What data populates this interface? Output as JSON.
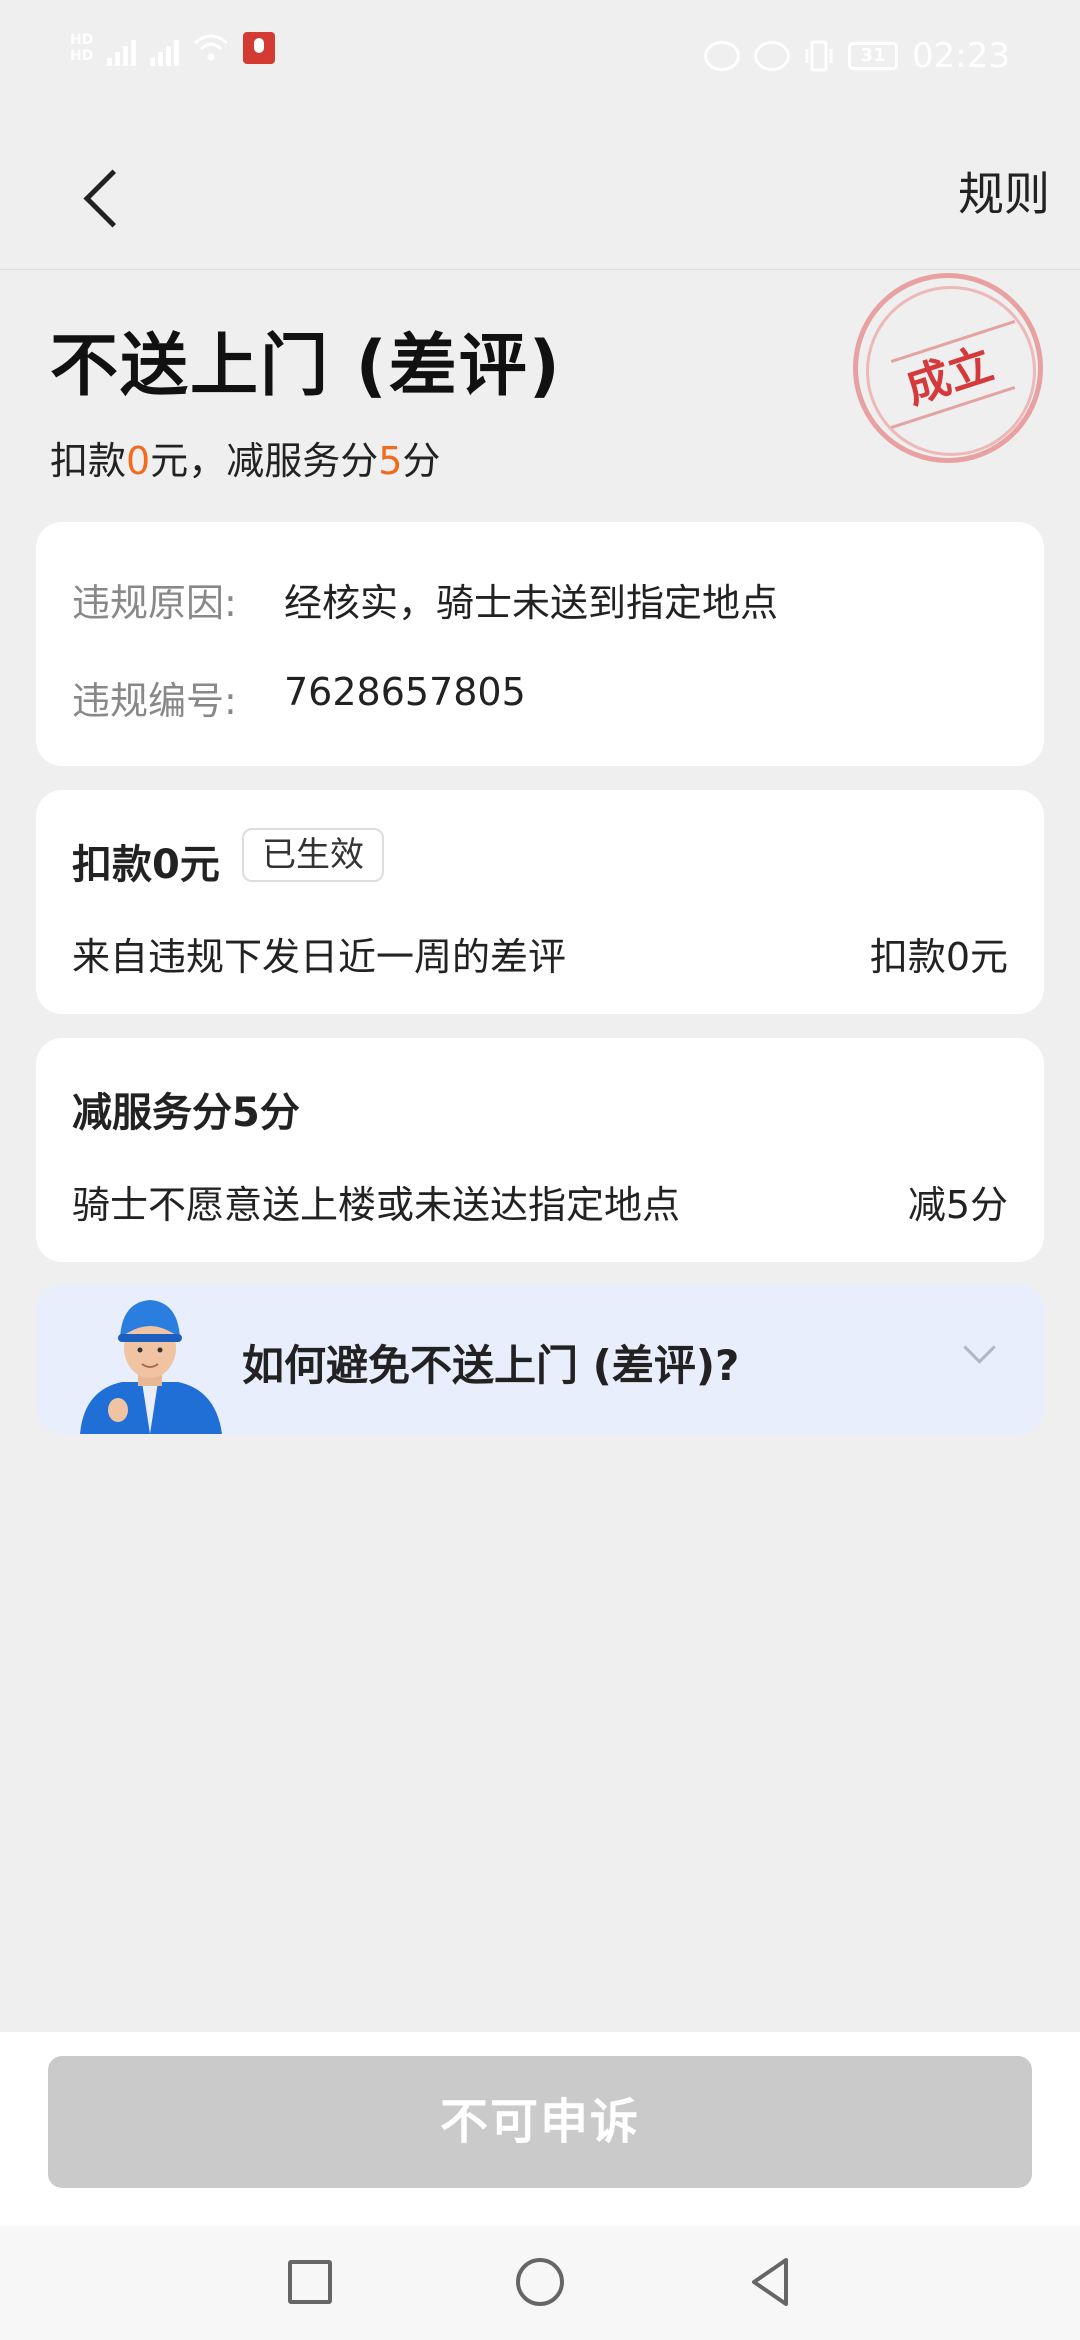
{
  "status_bar": {
    "time": "02:23",
    "battery": "31",
    "network_labels": [
      "HD",
      "HD"
    ],
    "colors": {
      "mic_badge": "#d23a32"
    }
  },
  "header": {
    "back_icon": "chevron-left-icon",
    "rules_label": "规则"
  },
  "summary": {
    "title": "不送上门 (差评)",
    "deduct_prefix": "扣款",
    "deduct_amount": "0",
    "deduct_unit": "元，减服务分",
    "score_amount": "5",
    "score_unit": "分",
    "stamp_text": "成立",
    "colors": {
      "highlight": "#f26b1d",
      "stamp": "#d6393a"
    }
  },
  "violation": {
    "reason_label": "违规原因:",
    "reason_value": "经核实，骑士未送到指定地点",
    "id_label": "违规编号:",
    "id_value": "7628657805"
  },
  "deduction_card": {
    "title": "扣款0元",
    "badge": "已生效",
    "description": "来自违规下发日近一周的差评",
    "amount": "扣款0元"
  },
  "score_card": {
    "title": "减服务分5分",
    "description": "骑士不愿意送上楼或未送达指定地点",
    "amount": "减5分"
  },
  "tip": {
    "text": "如何避免不送上门 (差评)?",
    "icon": "chevron-down-icon"
  },
  "footer": {
    "appeal_button": "不可申诉"
  },
  "nav": {
    "icons": [
      "recent-apps-icon",
      "home-icon",
      "back-icon"
    ]
  }
}
